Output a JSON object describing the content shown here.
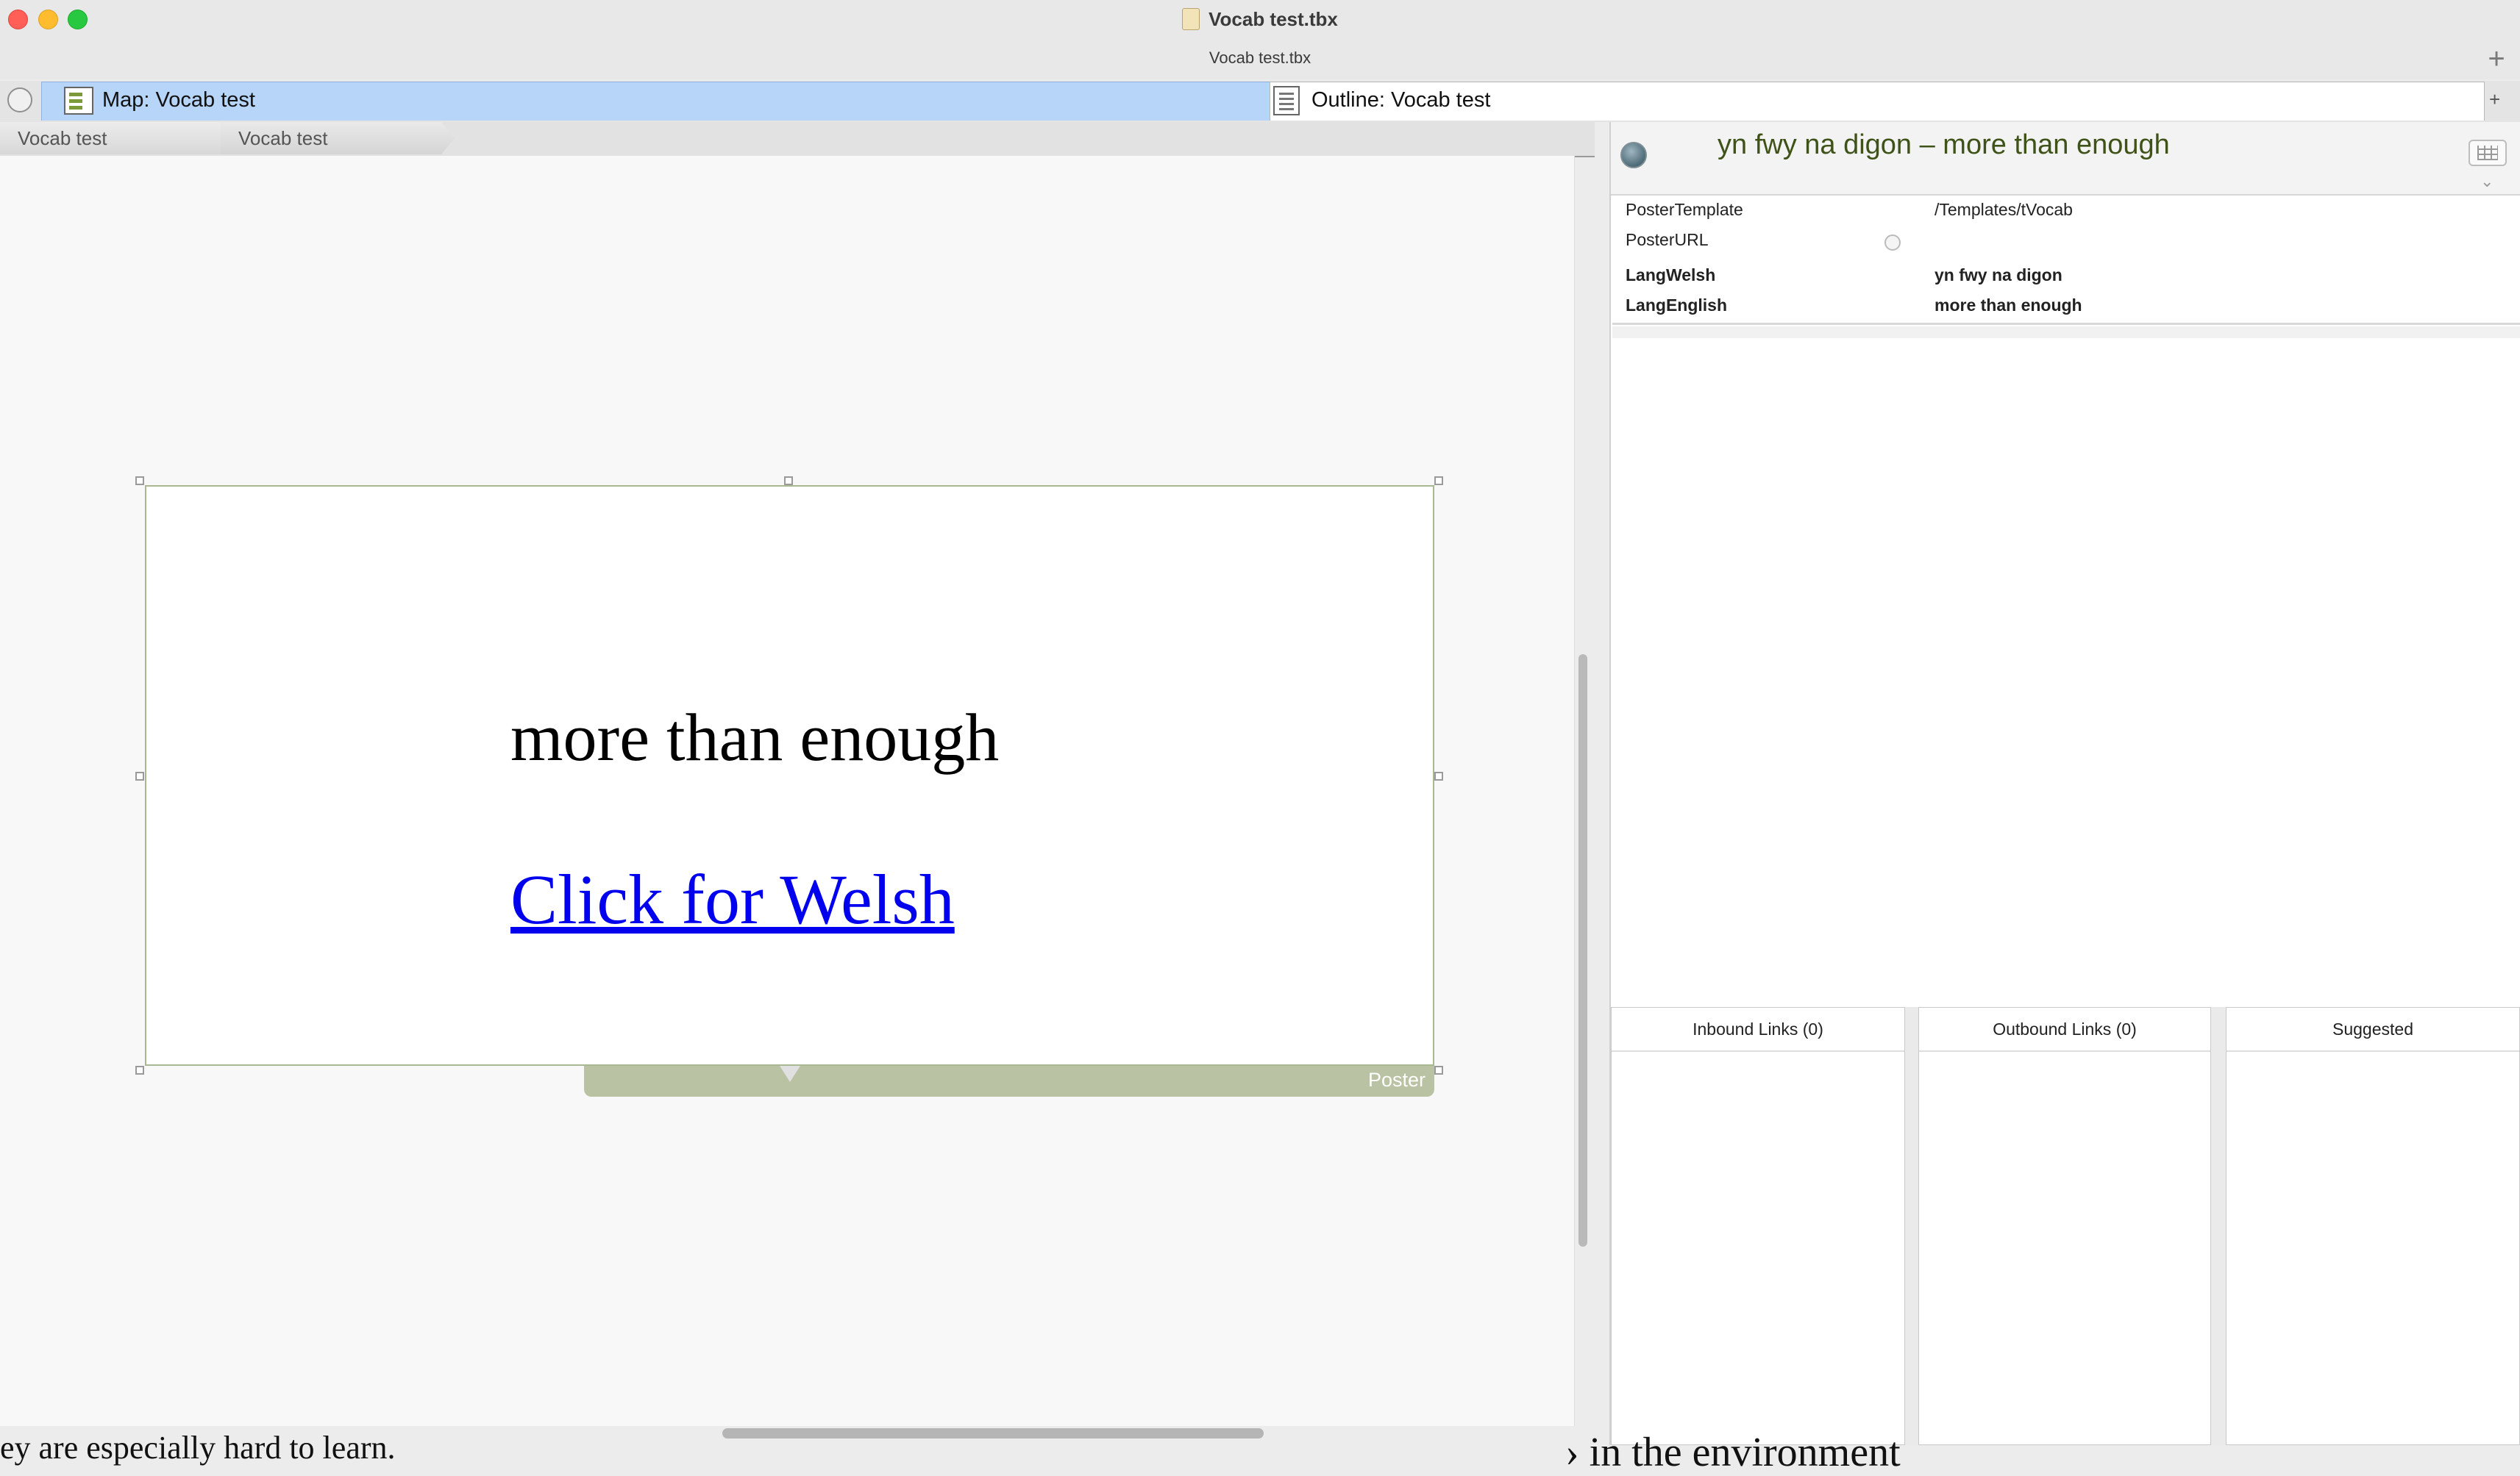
{
  "window": {
    "title": "Vocab test.tbx",
    "subtitle": "Vocab test.tbx"
  },
  "tabs": [
    {
      "label": "Map: Vocab test",
      "active": true
    },
    {
      "label": "Outline: Vocab test",
      "active": false
    }
  ],
  "breadcrumb": [
    "Vocab test",
    "Vocab test"
  ],
  "poster": {
    "english": "more than enough",
    "link_text": "Click for Welsh",
    "tab_label": "Poster"
  },
  "inspector": {
    "note_title": "yn fwy na digon – more than enough",
    "attributes": [
      {
        "name": "PosterTemplate",
        "value": "/Templates/tVocab",
        "bold": false
      },
      {
        "name": "PosterURL",
        "value": "",
        "bold": false
      },
      {
        "name": "LangWelsh",
        "value": "yn fwy na digon",
        "bold": true
      },
      {
        "name": "LangEnglish",
        "value": "more than enough",
        "bold": true
      }
    ]
  },
  "links": {
    "inbound": "Inbound Links (0)",
    "outbound": "Outbound Links (0)",
    "suggested": "Suggested"
  },
  "background_text": {
    "left": "ey are especially hard to learn.",
    "right": "› in the environment"
  },
  "colors": {
    "active_tab": "#b7d4f9",
    "poster_tab": "#b9c2a2",
    "note_title": "#3f5218",
    "link": "#0000ee"
  }
}
